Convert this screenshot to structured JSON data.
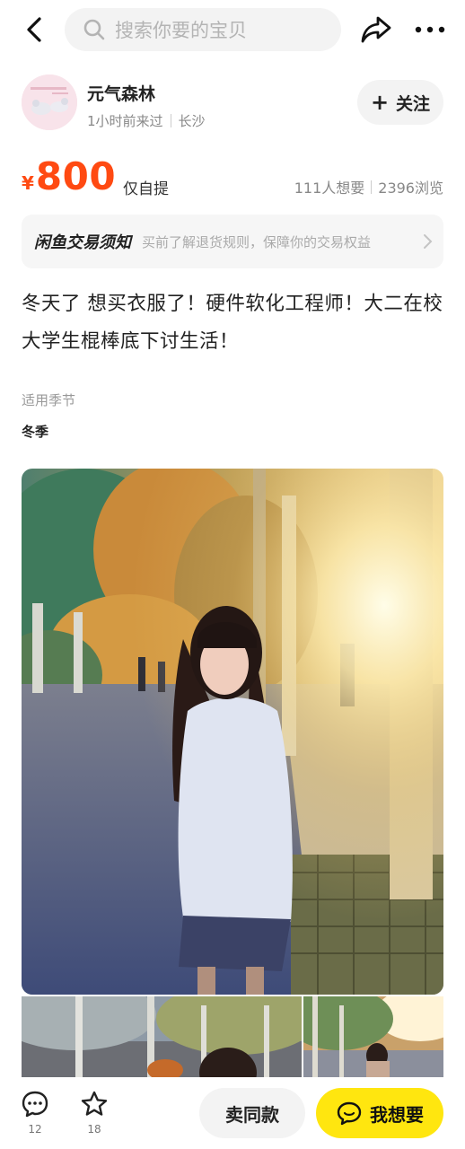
{
  "search": {
    "placeholder": "搜索你要的宝贝"
  },
  "icons": {
    "back": "back-arrow-icon",
    "search": "search-icon",
    "share": "share-icon",
    "more": "more-icon",
    "comment": "comment-icon",
    "favorite": "star-icon",
    "want": "chat-bubble-icon"
  },
  "seller": {
    "name": "元气森林",
    "last_seen": "1小时前来过",
    "location": "长沙",
    "follow_label": "关注"
  },
  "item": {
    "currency": "¥",
    "price": "800",
    "delivery": "仅自提",
    "wants": "111人想要",
    "views": "2396浏览",
    "description": "冬天了 想买衣服了！硬件软化工程师！大二在校大学生棍棒底下讨生活！",
    "attribute_label": "适用季节",
    "attribute_value": "冬季"
  },
  "notice": {
    "title": "闲鱼交易须知",
    "text": "买前了解退货规则，保障你的交易权益"
  },
  "bottom": {
    "comment_count": "12",
    "favorite_count": "18",
    "sell_same_label": "卖同款",
    "want_label": "我想要"
  },
  "colors": {
    "price": "#ff4a12",
    "want_button": "#ffe60f",
    "pill_bg": "#f3f3f3"
  }
}
